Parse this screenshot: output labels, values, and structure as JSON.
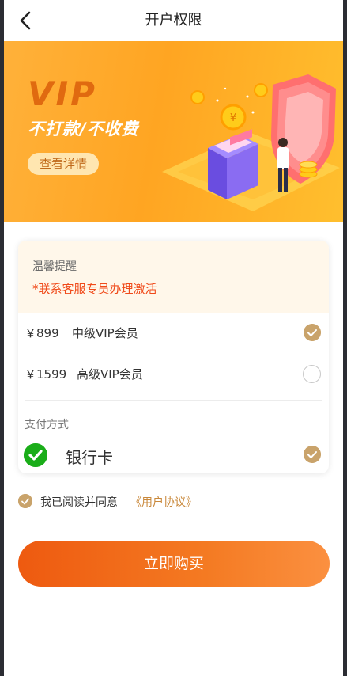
{
  "header": {
    "title": "开户权限",
    "back_icon": "chevron-left-icon"
  },
  "banner": {
    "vip": "VIP",
    "slogan": "不打款/不收费",
    "detail_button": "查看详情",
    "colors": {
      "bg": "#ffa522",
      "vip": "#e06a10"
    }
  },
  "notice": {
    "title": "温馨提醒",
    "text": "*联系客服专员办理激活"
  },
  "options": [
    {
      "price": "￥899",
      "name": "中级VIP会员",
      "selected": true
    },
    {
      "price": "￥1599",
      "name": "高级VIP会员",
      "selected": false
    }
  ],
  "payment": {
    "label": "支付方式",
    "method": "银行卡",
    "icon": "wechat-pay-icon",
    "selected": true
  },
  "agreement": {
    "text": "我已阅读并同意",
    "link": "《用户协议》",
    "checked": true
  },
  "buy_button": "立即购买",
  "colors": {
    "accent": "#f47a22",
    "check": "#c9a36b",
    "warning": "#f04a1a"
  }
}
